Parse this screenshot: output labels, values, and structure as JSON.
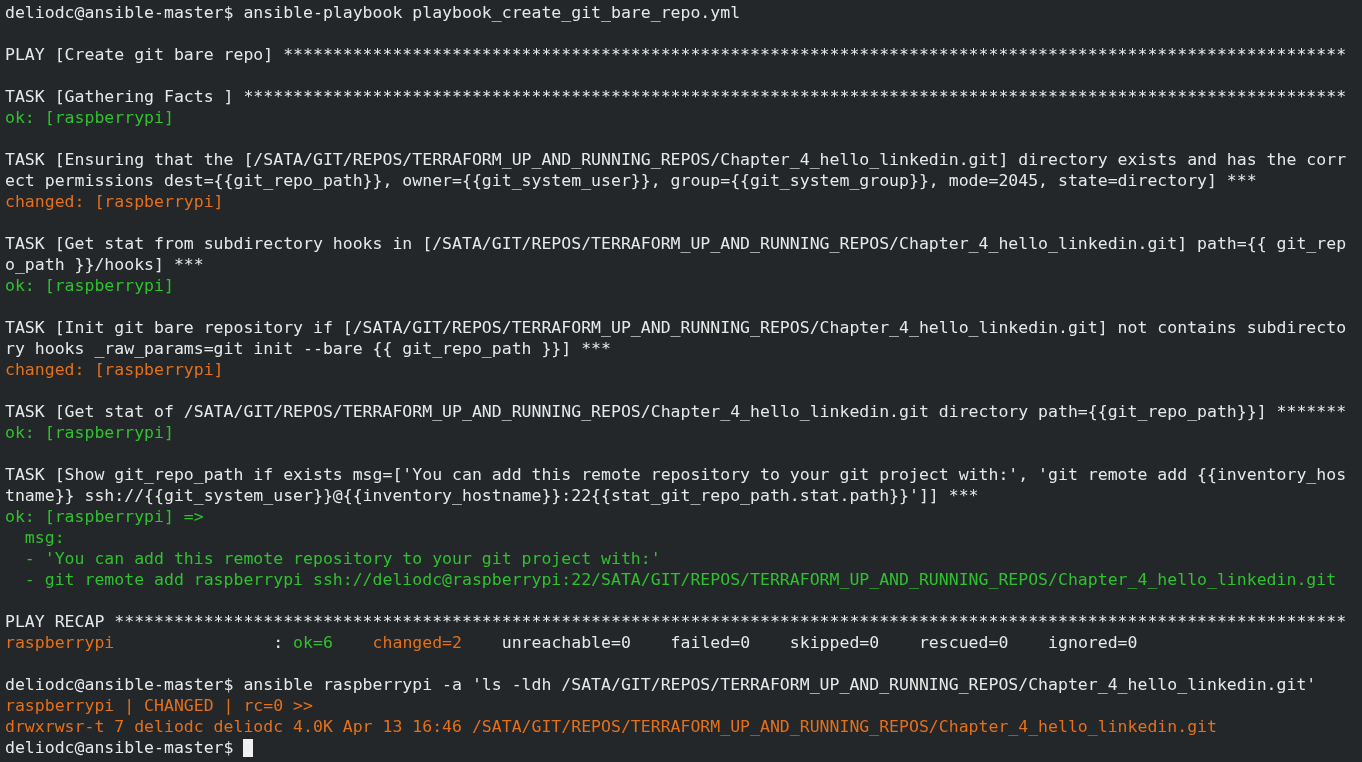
{
  "terminal": {
    "lines": [
      {
        "segments": [
          {
            "text": "deliodc@ansible-master$ ansible-playbook playbook_create_git_bare_repo.yml",
            "color": "#e8e8e8"
          }
        ]
      },
      {
        "kind": "blank"
      },
      {
        "segments": [
          {
            "text": "PLAY [Create git bare repo] ***********************************************************************************************************",
            "color": "#e8e8e8"
          }
        ]
      },
      {
        "kind": "blank"
      },
      {
        "segments": [
          {
            "text": "TASK [Gathering Facts ] ***************************************************************************************************************",
            "color": "#e8e8e8"
          }
        ]
      },
      {
        "segments": [
          {
            "text": "ok: [raspberrypi]",
            "color": "#2fc12f"
          }
        ]
      },
      {
        "kind": "blank"
      },
      {
        "segments": [
          {
            "text": "TASK [Ensuring that the [/SATA/GIT/REPOS/TERRAFORM_UP_AND_RUNNING_REPOS/Chapter_4_hello_linkedin.git] directory exists and has the corr",
            "color": "#e8e8e8"
          }
        ]
      },
      {
        "segments": [
          {
            "text": "ect permissions dest={{git_repo_path}}, owner={{git_system_user}}, group={{git_system_group}}, mode=2045, state=directory] ***",
            "color": "#e8e8e8"
          }
        ]
      },
      {
        "segments": [
          {
            "text": "changed: [raspberrypi]",
            "color": "#e4701c"
          }
        ]
      },
      {
        "kind": "blank"
      },
      {
        "segments": [
          {
            "text": "TASK [Get stat from subdirectory hooks in [/SATA/GIT/REPOS/TERRAFORM_UP_AND_RUNNING_REPOS/Chapter_4_hello_linkedin.git] path={{ git_rep",
            "color": "#e8e8e8"
          }
        ]
      },
      {
        "segments": [
          {
            "text": "o_path }}/hooks] ***",
            "color": "#e8e8e8"
          }
        ]
      },
      {
        "segments": [
          {
            "text": "ok: [raspberrypi]",
            "color": "#2fc12f"
          }
        ]
      },
      {
        "kind": "blank"
      },
      {
        "segments": [
          {
            "text": "TASK [Init git bare repository if [/SATA/GIT/REPOS/TERRAFORM_UP_AND_RUNNING_REPOS/Chapter_4_hello_linkedin.git] not contains subdirecto",
            "color": "#e8e8e8"
          }
        ]
      },
      {
        "segments": [
          {
            "text": "ry hooks _raw_params=git init --bare {{ git_repo_path }}] ***",
            "color": "#e8e8e8"
          }
        ]
      },
      {
        "segments": [
          {
            "text": "changed: [raspberrypi]",
            "color": "#e4701c"
          }
        ]
      },
      {
        "kind": "blank"
      },
      {
        "segments": [
          {
            "text": "TASK [Get stat of /SATA/GIT/REPOS/TERRAFORM_UP_AND_RUNNING_REPOS/Chapter_4_hello_linkedin.git directory path={{git_repo_path}}] *******",
            "color": "#e8e8e8"
          }
        ]
      },
      {
        "segments": [
          {
            "text": "ok: [raspberrypi]",
            "color": "#2fc12f"
          }
        ]
      },
      {
        "kind": "blank"
      },
      {
        "segments": [
          {
            "text": "TASK [Show git_repo_path if exists msg=['You can add this remote repository to your git project with:', 'git remote add {{inventory_hos",
            "color": "#e8e8e8"
          }
        ]
      },
      {
        "segments": [
          {
            "text": "tname}} ssh://{{git_system_user}}@{{inventory_hostname}}:22{{stat_git_repo_path.stat.path}}']] ***",
            "color": "#e8e8e8"
          }
        ]
      },
      {
        "segments": [
          {
            "text": "ok: [raspberrypi] =>",
            "color": "#2fc12f"
          }
        ]
      },
      {
        "segments": [
          {
            "text": "  msg:",
            "color": "#2fc12f"
          }
        ]
      },
      {
        "segments": [
          {
            "text": "  - 'You can add this remote repository to your git project with:'",
            "color": "#2fc12f"
          }
        ]
      },
      {
        "segments": [
          {
            "text": "  - git remote add raspberrypi ssh://deliodc@raspberrypi:22/SATA/GIT/REPOS/TERRAFORM_UP_AND_RUNNING_REPOS/Chapter_4_hello_linkedin.git",
            "color": "#2fc12f"
          }
        ]
      },
      {
        "kind": "blank"
      },
      {
        "segments": [
          {
            "text": "PLAY RECAP ****************************************************************************************************************************",
            "color": "#e8e8e8"
          }
        ]
      },
      {
        "segments": [
          {
            "text": "raspberrypi",
            "color": "#e4701c"
          },
          {
            "text": "                : ",
            "color": "#e8e8e8"
          },
          {
            "text": "ok=6",
            "color": "#2fc12f"
          },
          {
            "text": "    changed=2",
            "color": "#e4701c"
          },
          {
            "text": "    unreachable=0    failed=0    skipped=0    rescued=0    ignored=0",
            "color": "#e8e8e8"
          }
        ]
      },
      {
        "kind": "blank"
      },
      {
        "segments": [
          {
            "text": "deliodc@ansible-master$ ansible raspberrypi -a 'ls -ldh /SATA/GIT/REPOS/TERRAFORM_UP_AND_RUNNING_REPOS/Chapter_4_hello_linkedin.git'",
            "color": "#e8e8e8"
          }
        ]
      },
      {
        "segments": [
          {
            "text": "raspberrypi | CHANGED | rc=0 >>",
            "color": "#e4701c"
          }
        ]
      },
      {
        "segments": [
          {
            "text": "drwxrwsr-t 7 deliodc deliodc 4.0K Apr 13 16:46 /SATA/GIT/REPOS/TERRAFORM_UP_AND_RUNNING_REPOS/Chapter_4_hello_linkedin.git",
            "color": "#e4701c"
          }
        ]
      },
      {
        "segments": [
          {
            "text": "deliodc@ansible-master$",
            "color": "#e8e8e8"
          }
        ],
        "cursor": true
      }
    ]
  }
}
